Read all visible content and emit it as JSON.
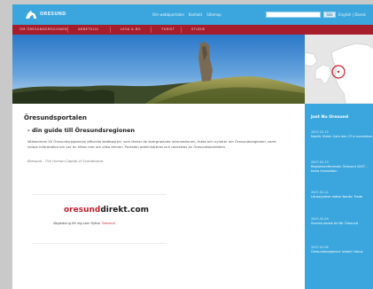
{
  "header": {
    "logo_text": "ORESUND",
    "links": [
      "Om webbportalen",
      "Kontakt",
      "Sitemap"
    ],
    "search_placeholder": "",
    "search_button": "Sök",
    "lang_links": "English | Dansk"
  },
  "nav": {
    "items": [
      "OM ÖRESUNDSREGIONEN",
      "ARBETSLIV",
      "LEVA & BO",
      "TURIST",
      "STUDIE"
    ]
  },
  "main": {
    "title": "Öresundsportalen",
    "subtitle": "- din guide till Öresundsregionen",
    "paragraph": "Välkommen till Öresundsregionens officiella webbportal, som länkar de övergripande informationen, fakta och nyheter om Öresundsregionen, samt vidare information om var du hittar mer om olika ämnen. Portalen administreras och utvecklas av Öresundskomiteen.",
    "tagline": "Øresund - The Human Capital of Scandinavia",
    "promo": {
      "logo_main": "oresund",
      "logo_suffix": "direkt.com",
      "text": "Vägledning för dig som flyttar",
      "text_link": "Öresund"
    }
  },
  "sidebar": {
    "heading": "Just Nu Oresund",
    "items": [
      {
        "date": "2007-02-15",
        "text": "Nordic Green Cars den 27:e november"
      },
      {
        "date": "2007-02-13",
        "text": "Regionkonferensen Öresund 2007 - tema Innovation"
      },
      {
        "date": "2007-02-12",
        "text": "Länsstyrelse möter Nordic Trade"
      },
      {
        "date": "2007-02-09",
        "text": "Svensk-dansk tid för Öresund"
      },
      {
        "date": "2007-02-06",
        "text": "Öresundsregionen: bredd i fokus"
      }
    ]
  }
}
